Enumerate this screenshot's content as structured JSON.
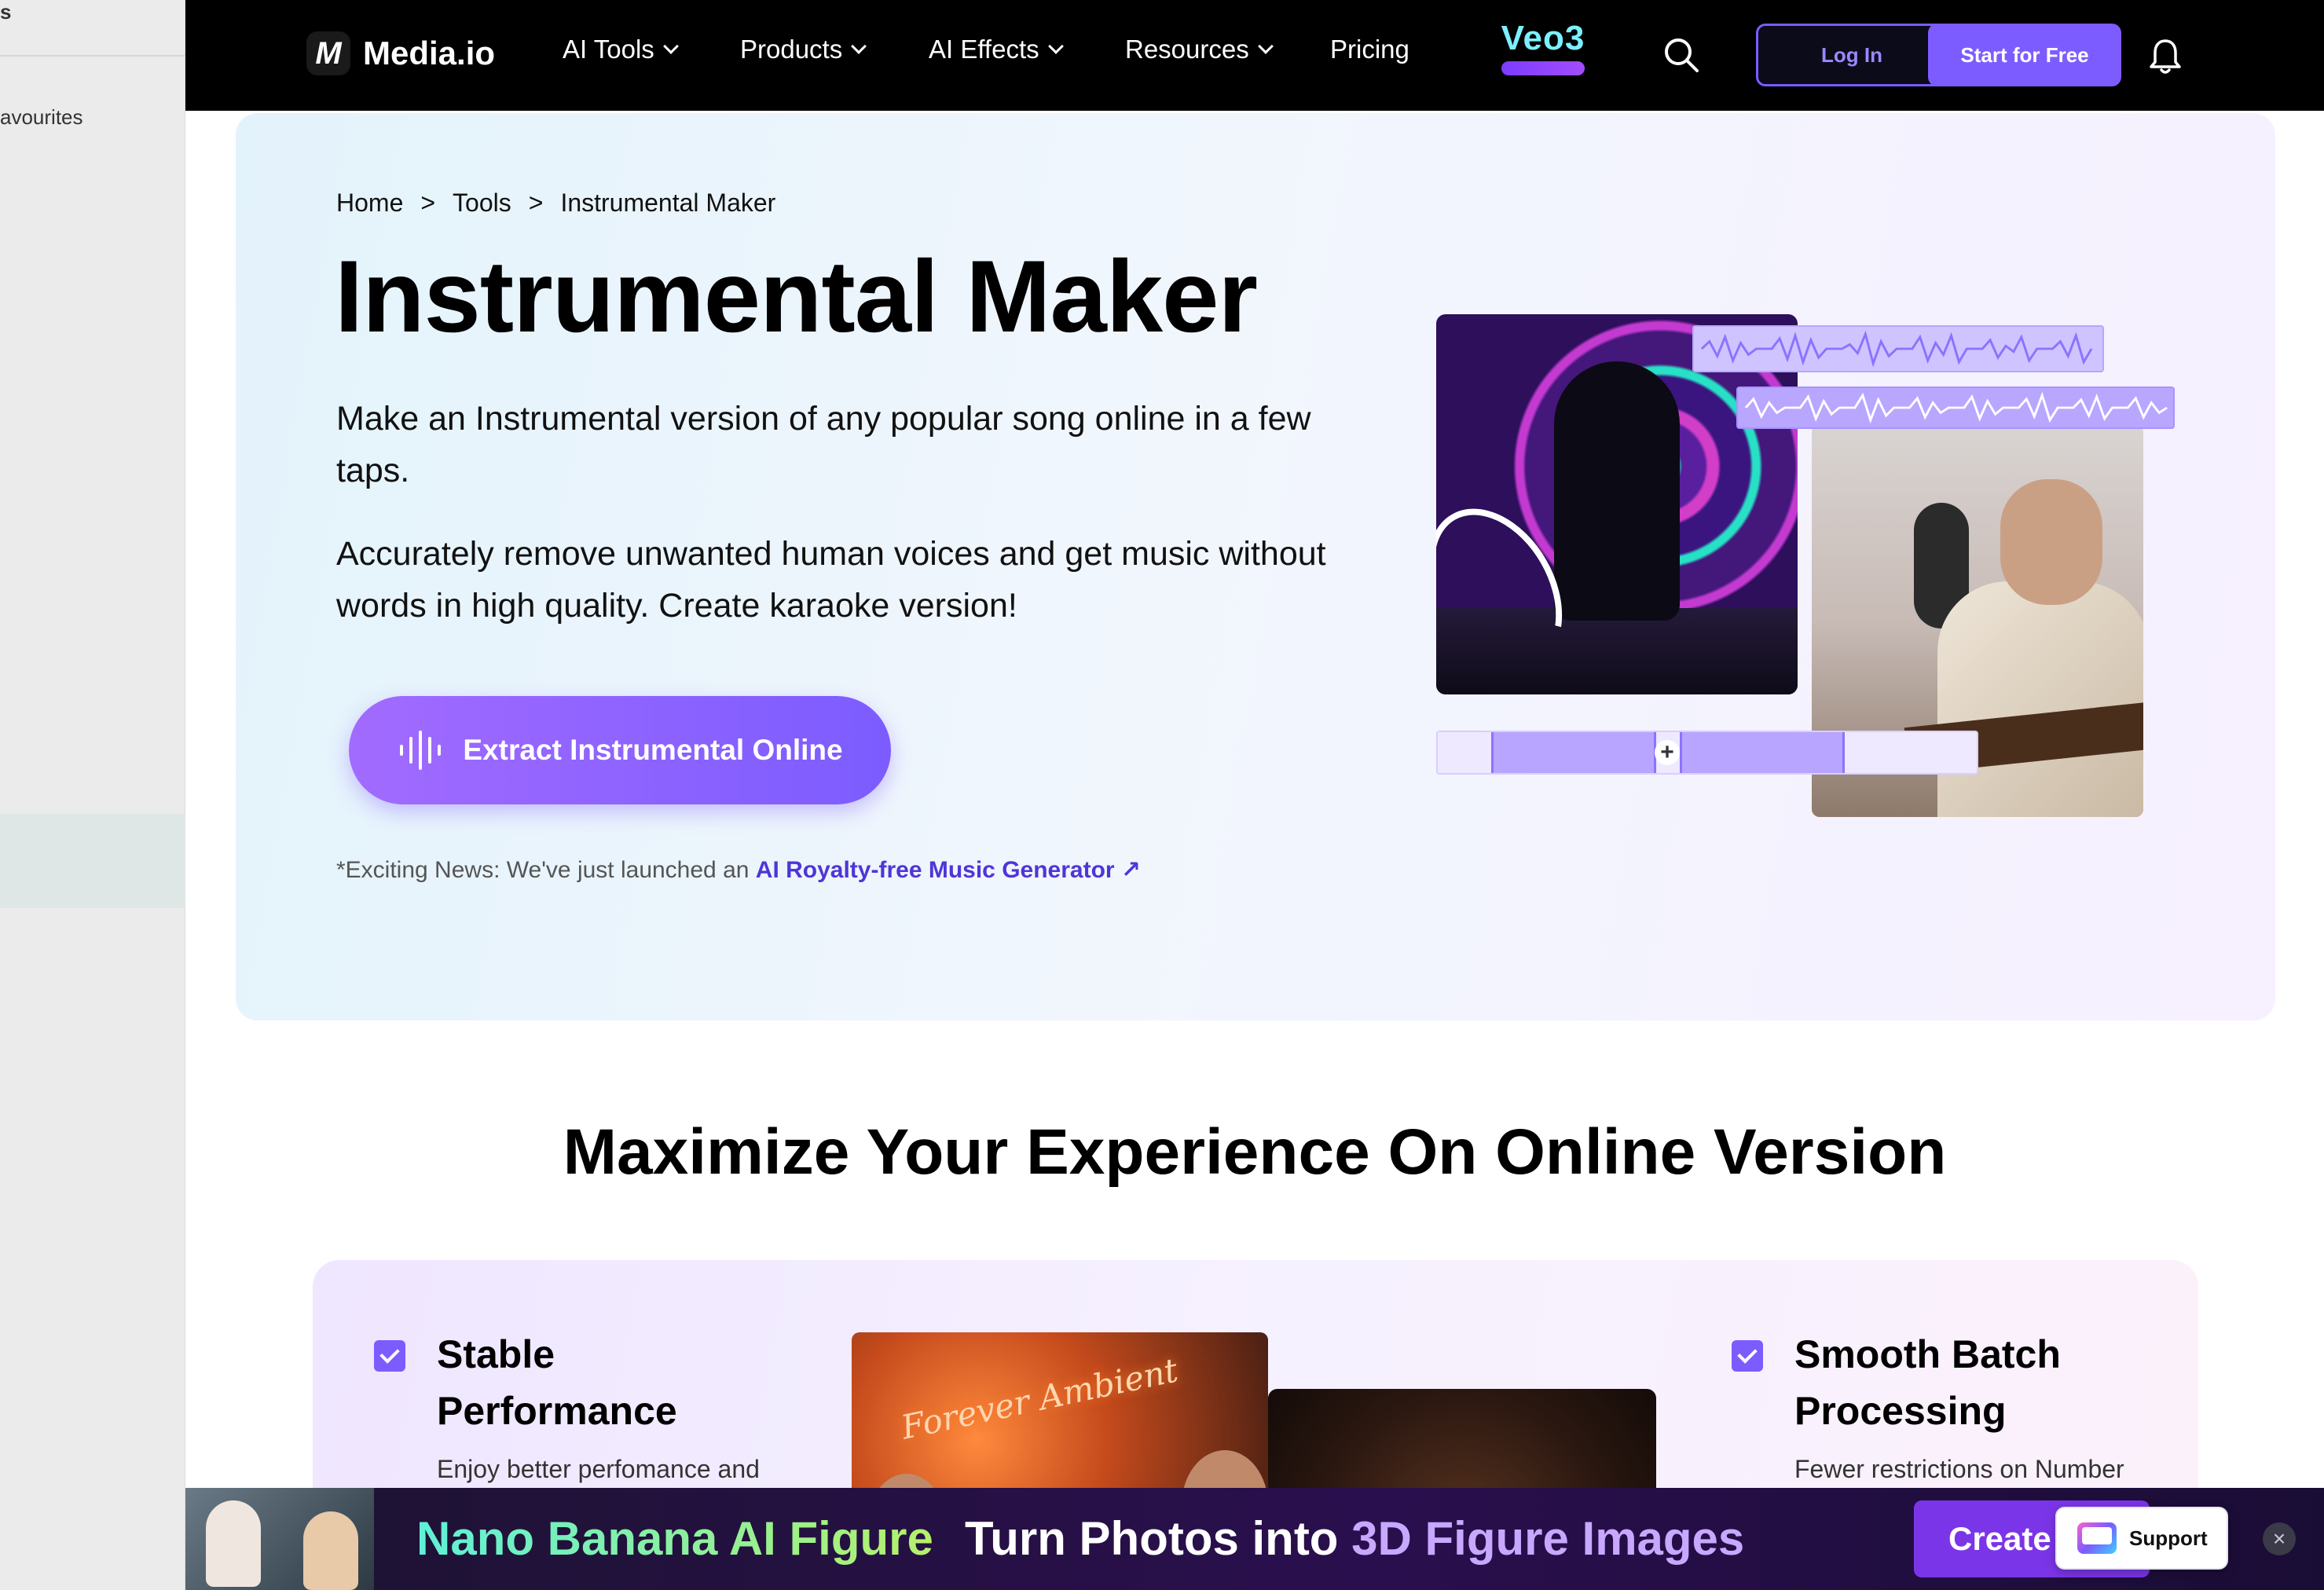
{
  "side_panel": {
    "top_label": "s",
    "favourites_label": "avourites"
  },
  "nav": {
    "logo_text": "Media.io",
    "logo_mark": "M",
    "items": [
      {
        "label": "AI Tools",
        "has_dropdown": true
      },
      {
        "label": "Products",
        "has_dropdown": true
      },
      {
        "label": "AI Effects",
        "has_dropdown": true
      },
      {
        "label": "Resources",
        "has_dropdown": true
      },
      {
        "label": "Pricing",
        "has_dropdown": false
      }
    ],
    "veo_badge": "Veo3",
    "login_label": "Log In",
    "start_label": "Start for Free",
    "icons": {
      "search": "search-icon",
      "bell": "bell-icon"
    }
  },
  "hero": {
    "breadcrumb": [
      "Home",
      ">",
      "Tools",
      ">",
      "Instrumental Maker"
    ],
    "title": "Instrumental Maker",
    "desc1": "Make an Instrumental version of any popular song online in a few taps.",
    "desc2": "Accurately remove unwanted human voices and get music without words in high quality. Create karaoke version!",
    "cta_label": "Extract Instrumental Online",
    "cta_icon": "waveform-icon",
    "news_prefix": "*Exciting News: We've just launched an ",
    "news_link": "AI Royalty-free Music Generator ↗"
  },
  "section2": {
    "title": "Maximize Your Experience On Online Version",
    "features": [
      {
        "title": "Stable Performance",
        "desc": "Enjoy better perfomance and"
      },
      {
        "title": "Smooth Batch Processing",
        "desc": "Fewer restrictions on Number"
      }
    ],
    "image_neon_text": "Forever Ambient"
  },
  "banner": {
    "highlight": "Nano Banana AI Figure",
    "text_plain": "Turn Photos into ",
    "text_accent": "3D Figure Images",
    "create_label": "Create",
    "support_label": "Support",
    "close_label": "×"
  },
  "colors": {
    "accent": "#7d5cff",
    "nav_bg": "#000000",
    "link": "#4f35d8",
    "banner_bg": "#2a0f4e"
  }
}
